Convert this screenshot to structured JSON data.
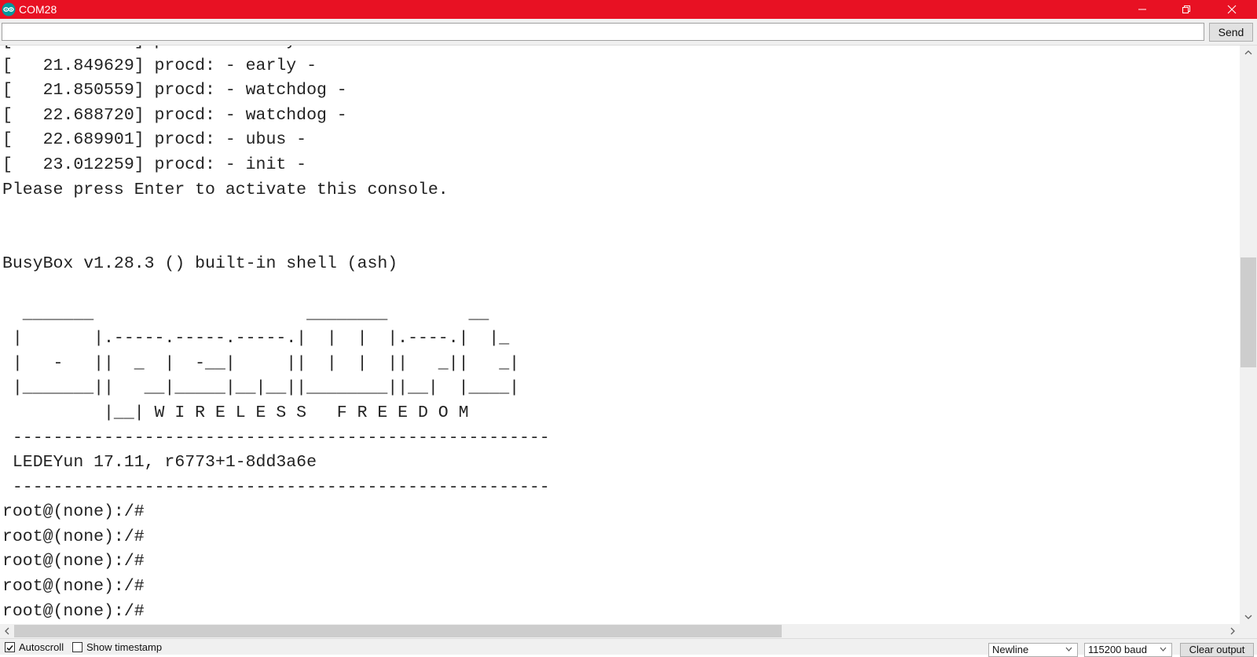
{
  "window": {
    "title": "COM28",
    "accent_color": "#e81123",
    "icons": [
      "arduino-logo-icon",
      "minimize-icon",
      "restore-icon",
      "close-icon"
    ]
  },
  "send_bar": {
    "input_value": "",
    "send_label": "Send"
  },
  "console": {
    "lines": [
      "[   21.849629] procd: - early -",
      "[   21.849629] procd: - early -",
      "[   21.850559] procd: - watchdog -",
      "[   22.688720] procd: - watchdog -",
      "[   22.689901] procd: - ubus -",
      "[   23.012259] procd: - init -",
      "Please press Enter to activate this console.",
      "",
      "",
      "BusyBox v1.28.3 () built-in shell (ash)",
      "",
      "  _______                     ________        __",
      " |       |.-----.-----.-----.|  |  |  |.----.|  |_",
      " |   -   ||  _  |  -__|     ||  |  |  ||   _||   _|",
      " |_______||   __|_____|__|__||________||__|  |____|",
      "          |__| W I R E L E S S   F R E E D O M",
      " -----------------------------------------------------",
      " LEDEYun 17.11, r6773+1-8dd3a6e",
      " -----------------------------------------------------",
      "root@(none):/#",
      "root@(none):/#",
      "root@(none):/#",
      "root@(none):/#",
      "root@(none):/#"
    ]
  },
  "bottom_bar": {
    "autoscroll_label": "Autoscroll",
    "autoscroll_checked": true,
    "timestamp_label": "Show timestamp",
    "timestamp_checked": false,
    "line_ending": "Newline",
    "baud_rate": "115200 baud",
    "clear_label": "Clear output"
  },
  "scroll": {
    "vertical_position": 0.45,
    "horizontal_position": 0.0
  }
}
